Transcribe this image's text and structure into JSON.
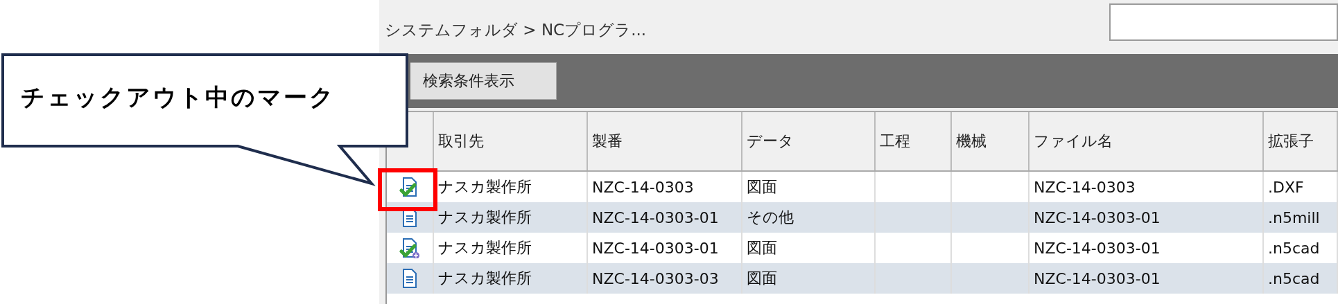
{
  "callout": {
    "text": "チェックアウト中のマーク"
  },
  "breadcrumb": "システムフォルダ > NCプログラ...",
  "toolbar": {
    "button": "検索条件表示"
  },
  "table": {
    "columns": [
      "取引先",
      "製番",
      "データ",
      "工程",
      "機械",
      "ファイル名",
      "拡張子"
    ],
    "rows": [
      {
        "kind": "checkout",
        "client": "ナスカ製作所",
        "serial": "NZC-14-0303",
        "data": "図面",
        "file_name": "NZC-14-0303",
        "extension": ".DXF"
      },
      {
        "kind": "document",
        "client": "ナスカ製作所",
        "serial": "NZC-14-0303-01",
        "data": "その他",
        "file_name": "NZC-14-0303-01",
        "extension": ".n5mill"
      },
      {
        "kind": "checkout-linked",
        "client": "ナスカ製作所",
        "serial": "NZC-14-0303-01",
        "data": "図面",
        "file_name": "NZC-14-0303-01",
        "extension": ".n5cad"
      },
      {
        "kind": "document",
        "client": "ナスカ製作所",
        "serial": "NZC-14-0303-03",
        "data": "図面",
        "file_name": "NZC-14-0303-01",
        "extension": ".n5cad"
      }
    ]
  }
}
